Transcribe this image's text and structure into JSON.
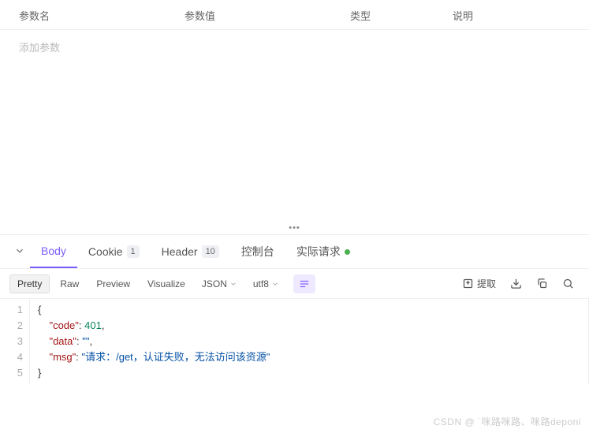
{
  "params_header": {
    "name": "参数名",
    "value": "参数值",
    "type": "类型",
    "desc": "说明"
  },
  "add_param_placeholder": "添加参数",
  "response_tabs": {
    "body": "Body",
    "cookie": {
      "label": "Cookie",
      "count": "1"
    },
    "header": {
      "label": "Header",
      "count": "10"
    },
    "console": "控制台",
    "actual": "实际请求"
  },
  "toolbar": {
    "pretty": "Pretty",
    "raw": "Raw",
    "preview": "Preview",
    "visualize": "Visualize",
    "format": "JSON",
    "encoding": "utf8",
    "extract": "提取"
  },
  "code": {
    "line_numbers": [
      "1",
      "2",
      "3",
      "4",
      "5"
    ],
    "json": {
      "code_key": "\"code\"",
      "code_val": "401",
      "data_key": "\"data\"",
      "data_val": "\"\"",
      "msg_key": "\"msg\"",
      "msg_val": "\"请求：/get，认证失败，无法访问该资源\""
    }
  },
  "watermark": "CSDN @ ˙咪路咪路、咪路deponi"
}
